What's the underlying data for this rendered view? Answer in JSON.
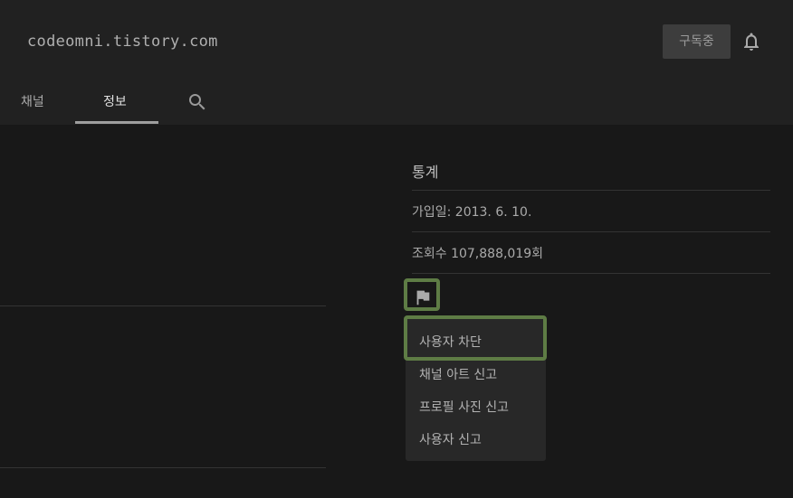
{
  "header": {
    "watermark": "codeomni.tistory.com",
    "subscribe_label": "구독중",
    "bell_icon": "bell-icon"
  },
  "tabs": [
    {
      "label": "채널",
      "active": false
    },
    {
      "label": "정보",
      "active": true
    }
  ],
  "search_icon": "search-icon",
  "stats": {
    "title": "통계",
    "joined": "가입일: 2013. 6. 10.",
    "views": "조회수 107,888,019회"
  },
  "flag_icon": "flag-icon",
  "menu": {
    "items": [
      {
        "label": "사용자 차단"
      },
      {
        "label": "채널 아트 신고"
      },
      {
        "label": "프로필 사진 신고"
      },
      {
        "label": "사용자 신고"
      }
    ]
  },
  "colors": {
    "background": "#181818",
    "header": "#212121",
    "highlight": "#5e7c45"
  }
}
